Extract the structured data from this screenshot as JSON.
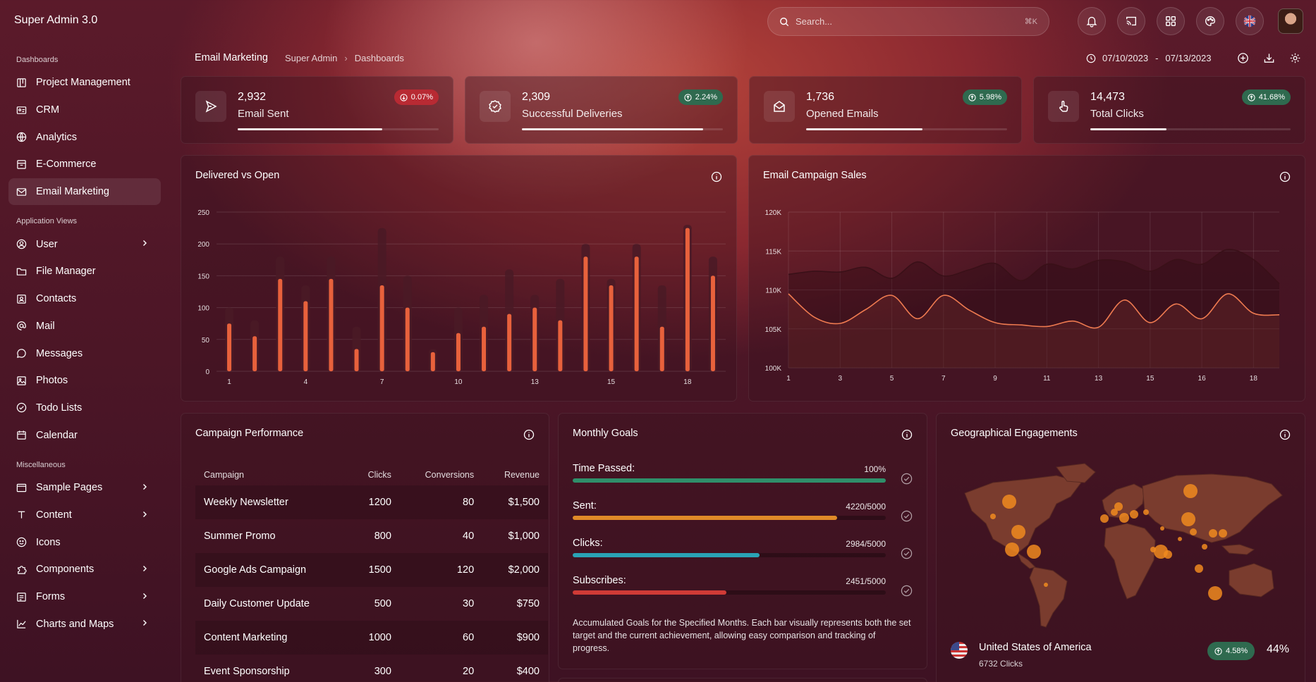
{
  "app": {
    "title": "Super Admin 3.0"
  },
  "search": {
    "placeholder": "Search...",
    "shortcut": "⌘K"
  },
  "sidebar": {
    "sections": [
      {
        "title": "Dashboards",
        "items": [
          {
            "label": "Project Management",
            "icon": "kanban-icon"
          },
          {
            "label": "CRM",
            "icon": "id-card-icon"
          },
          {
            "label": "Analytics",
            "icon": "globe-icon"
          },
          {
            "label": "E-Commerce",
            "icon": "store-icon"
          },
          {
            "label": "Email Marketing",
            "icon": "mail-icon",
            "active": true
          }
        ]
      },
      {
        "title": "Application Views",
        "items": [
          {
            "label": "User",
            "icon": "user-icon",
            "chevron": true
          },
          {
            "label": "File Manager",
            "icon": "folder-icon"
          },
          {
            "label": "Contacts",
            "icon": "contacts-icon"
          },
          {
            "label": "Mail",
            "icon": "at-icon"
          },
          {
            "label": "Messages",
            "icon": "chat-icon"
          },
          {
            "label": "Photos",
            "icon": "image-icon"
          },
          {
            "label": "Todo Lists",
            "icon": "check-circle-icon"
          },
          {
            "label": "Calendar",
            "icon": "calendar-icon"
          }
        ]
      },
      {
        "title": "Miscellaneous",
        "items": [
          {
            "label": "Sample Pages",
            "icon": "browser-icon",
            "chevron": true
          },
          {
            "label": "Content",
            "icon": "type-icon",
            "chevron": true
          },
          {
            "label": "Icons",
            "icon": "smile-icon"
          },
          {
            "label": "Components",
            "icon": "puzzle-icon",
            "chevron": true
          },
          {
            "label": "Forms",
            "icon": "form-icon",
            "chevron": true
          },
          {
            "label": "Charts and Maps",
            "icon": "line-chart-icon",
            "chevron": true
          }
        ]
      }
    ]
  },
  "header": {
    "page_title": "Email Marketing",
    "breadcrumb": [
      "Super Admin",
      "Dashboards"
    ],
    "date_from": "07/10/2023",
    "date_to": "07/13/2023",
    "date_separator": "-"
  },
  "stats": [
    {
      "value": "2,932",
      "label": "Email Sent",
      "change": "0.07%",
      "direction": "down",
      "progress": 0.72,
      "icon": "send-icon"
    },
    {
      "value": "2,309",
      "label": "Successful Deliveries",
      "change": "2.24%",
      "direction": "up",
      "progress": 0.9,
      "icon": "verified-badge-icon"
    },
    {
      "value": "1,736",
      "label": "Opened Emails",
      "change": "5.98%",
      "direction": "up",
      "progress": 0.58,
      "icon": "mail-open-icon"
    },
    {
      "value": "14,473",
      "label": "Total Clicks",
      "change": "41.68%",
      "direction": "up",
      "progress": 0.38,
      "icon": "pointer-hand-icon"
    }
  ],
  "colors": {
    "bar_delivered": "#4a1a26",
    "bar_open": "#e8613c",
    "badge_down": "#b82a33",
    "badge_up": "#2f6a4f",
    "goal_time": "#2f8f6a",
    "goal_sent": "#e08a28",
    "goal_clicks": "#2aa3b5",
    "goal_subs": "#d03b36"
  },
  "chart_data": [
    {
      "type": "bar",
      "title": "Delivered vs Open",
      "x": [
        1,
        2,
        3,
        4,
        5,
        6,
        7,
        8,
        9,
        10,
        11,
        12,
        13,
        14,
        15,
        16,
        17,
        18,
        19,
        20
      ],
      "xticks": [
        "1",
        "4",
        "7",
        "10",
        "13",
        "15",
        "18"
      ],
      "xtick_positions": [
        1,
        4,
        7,
        10,
        13,
        16,
        19
      ],
      "ylim": [
        0,
        250
      ],
      "yticks": [
        "0",
        "50",
        "100",
        "150",
        "200",
        "250"
      ],
      "series": [
        {
          "values": [
            100,
            80,
            180,
            135,
            180,
            70,
            225,
            150,
            35,
            100,
            120,
            160,
            120,
            145,
            200,
            145,
            200,
            135,
            230,
            180
          ]
        },
        {
          "values": [
            75,
            55,
            145,
            110,
            145,
            35,
            135,
            100,
            30,
            60,
            70,
            90,
            100,
            80,
            180,
            135,
            180,
            70,
            225,
            150
          ]
        }
      ],
      "grid": true
    },
    {
      "type": "line",
      "title": "Email Campaign Sales",
      "x": [
        1,
        2,
        3,
        4,
        5,
        6,
        7,
        8,
        9,
        10,
        11,
        12,
        13,
        14,
        15,
        16,
        17,
        18,
        19,
        20
      ],
      "xticks": [
        "1",
        "3",
        "5",
        "7",
        "9",
        "11",
        "13",
        "15",
        "16",
        "18"
      ],
      "xtick_positions": [
        1,
        3,
        5,
        7,
        9,
        11,
        13,
        15,
        17,
        19
      ],
      "ylim": [
        100000,
        120000
      ],
      "yticks": [
        "100K",
        "105K",
        "110K",
        "115K",
        "120K"
      ],
      "series": [
        {
          "values": [
            112000,
            112400,
            112300,
            112900,
            111500,
            113600,
            111800,
            112600,
            113400,
            111200,
            113300,
            112700,
            113800,
            113600,
            112400,
            113900,
            113300,
            115200,
            113900,
            110800
          ]
        },
        {
          "values": [
            109500,
            106500,
            105700,
            107500,
            109300,
            106300,
            109300,
            107400,
            105800,
            105500,
            105300,
            106000,
            105200,
            108700,
            105800,
            108200,
            106300,
            109500,
            107000,
            106800
          ]
        }
      ],
      "grid": true
    }
  ],
  "campaign": {
    "title": "Campaign Performance",
    "columns": [
      "Campaign",
      "Clicks",
      "Conversions",
      "Revenue"
    ],
    "rows": [
      [
        "Weekly Newsletter",
        "1200",
        "80",
        "$1,500"
      ],
      [
        "Summer Promo",
        "800",
        "40",
        "$1,000"
      ],
      [
        "Google Ads Campaign",
        "1500",
        "120",
        "$2,000"
      ],
      [
        "Daily Customer Update",
        "500",
        "30",
        "$750"
      ],
      [
        "Content Marketing",
        "1000",
        "60",
        "$900"
      ],
      [
        "Event Sponsorship",
        "300",
        "20",
        "$400"
      ]
    ]
  },
  "goals": {
    "title": "Monthly Goals",
    "items": [
      {
        "label": "Time Passed:",
        "value": "100%",
        "fraction": 1.0
      },
      {
        "label": "Sent:",
        "value": "4220/5000",
        "fraction": 0.844
      },
      {
        "label": "Clicks:",
        "value": "2984/5000",
        "fraction": 0.597
      },
      {
        "label": "Subscribes:",
        "value": "2451/5000",
        "fraction": 0.49
      }
    ],
    "note": "Accumulated Goals for the Specified Months. Each bar visually represents both the set target and the current achievement, allowing easy comparison and tracking of progress."
  },
  "geo": {
    "title": "Geographical Engagements",
    "country": "United States of America",
    "clicks": "6732 Clicks",
    "change": "4.58%",
    "percent": "44%"
  }
}
